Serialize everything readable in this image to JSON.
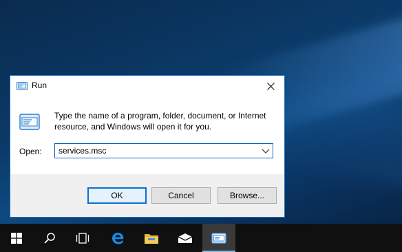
{
  "window": {
    "title": "Run",
    "close_glyph": "✕"
  },
  "dialog": {
    "description": "Type the name of a program, folder, document, or Internet resource, and Windows will open it for you.",
    "open_label": "Open:",
    "input_value": "services.msc",
    "buttons": {
      "ok": "OK",
      "cancel": "Cancel",
      "browse": "Browse..."
    }
  },
  "taskbar": {
    "items": [
      {
        "icon": "windows-start-icon"
      },
      {
        "icon": "search-icon"
      },
      {
        "icon": "task-view-icon"
      },
      {
        "icon": "edge-icon"
      },
      {
        "icon": "file-explorer-icon"
      },
      {
        "icon": "mail-icon"
      },
      {
        "icon": "run-icon",
        "active": true
      }
    ]
  },
  "colors": {
    "accent": "#0a6fd3",
    "taskbar": "#101010",
    "dialog_footer": "#f0f0f0"
  }
}
